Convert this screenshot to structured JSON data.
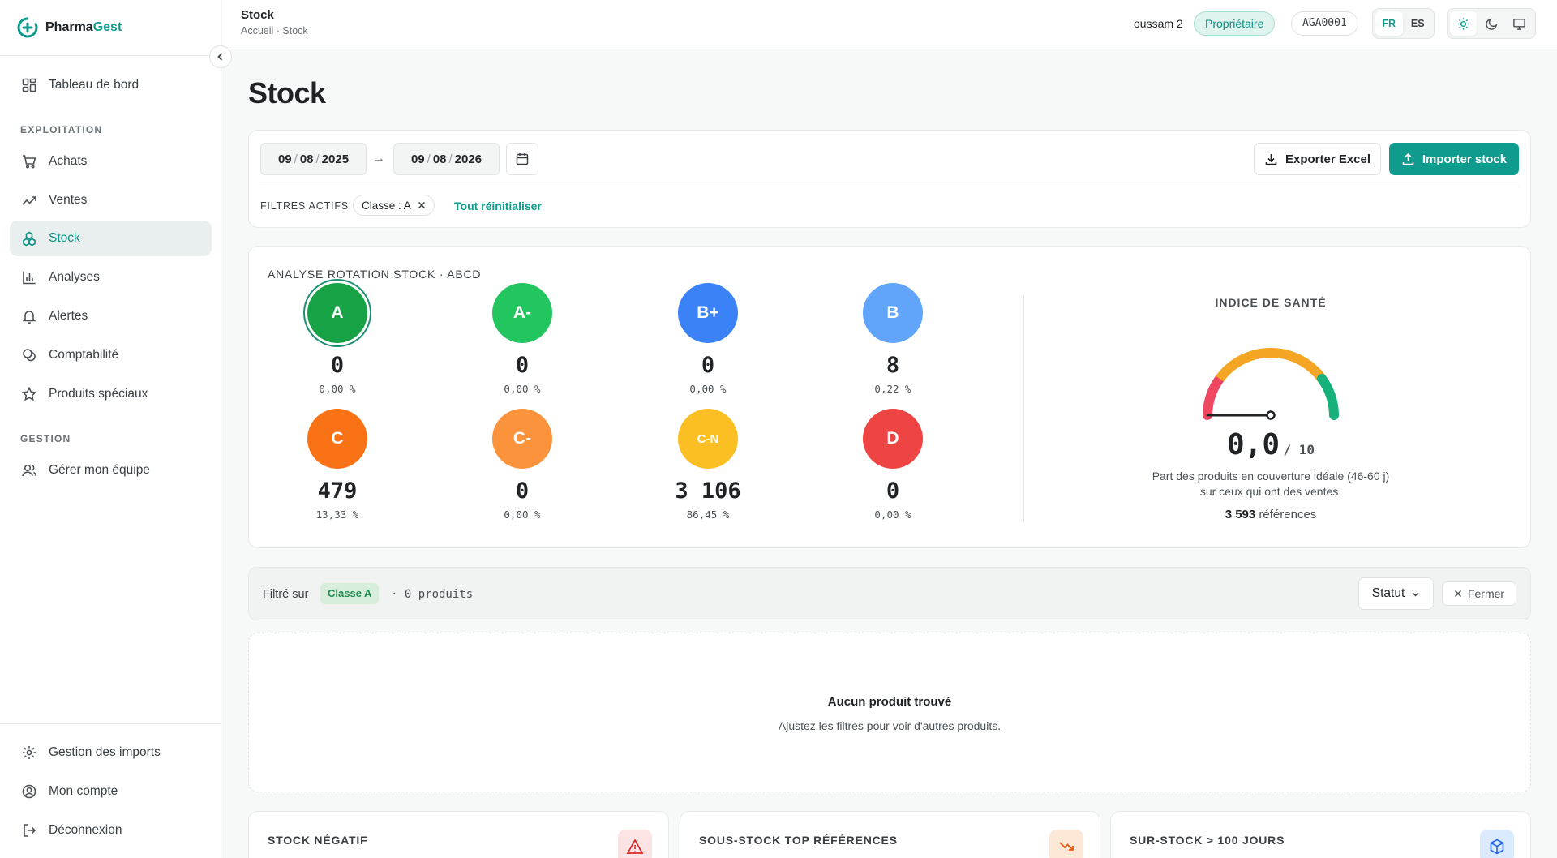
{
  "app": {
    "name_part1": "Pharma",
    "name_part2": "Gest"
  },
  "sidebar": {
    "dashboard": "Tableau de bord",
    "section_exploitation": "EXPLOITATION",
    "achats": "Achats",
    "ventes": "Ventes",
    "stock": "Stock",
    "analyses": "Analyses",
    "alertes": "Alertes",
    "comptabilite": "Comptabilité",
    "produits_speciaux": "Produits spéciaux",
    "section_gestion": "GESTION",
    "equipe": "Gérer mon équipe",
    "imports": "Gestion des imports",
    "compte": "Mon compte",
    "deconnexion": "Déconnexion"
  },
  "topbar": {
    "title": "Stock",
    "breadcrumb": "Accueil · Stock",
    "user": "oussam 2",
    "role": "Propriétaire",
    "code": "AGA0001",
    "lang_fr": "FR",
    "lang_es": "ES"
  },
  "page": {
    "title": "Stock"
  },
  "filters": {
    "date_from": {
      "d": "09",
      "m": "08",
      "y": "2025"
    },
    "date_to": {
      "d": "09",
      "m": "08",
      "y": "2026"
    },
    "arrow": "→",
    "export": "Exporter Excel",
    "import": "Importer stock",
    "active_label": "FILTRES ACTIFS",
    "chip": "Classe : A",
    "reset": "Tout réinitialiser"
  },
  "abcd": {
    "title": "ANALYSE ROTATION STOCK · ABCD",
    "classes": [
      {
        "label": "A",
        "count": "0",
        "pct": "0,00 %",
        "color": "#17a345"
      },
      {
        "label": "A-",
        "count": "0",
        "pct": "0,00 %",
        "color": "#22c55e"
      },
      {
        "label": "B+",
        "count": "0",
        "pct": "0,00 %",
        "color": "#3b82f6"
      },
      {
        "label": "B",
        "count": "8",
        "pct": "0,22 %",
        "color": "#60a5fa"
      },
      {
        "label": "C",
        "count": "479",
        "pct": "13,33 %",
        "color": "#f97316"
      },
      {
        "label": "C-",
        "count": "0",
        "pct": "0,00 %",
        "color": "#fb923c"
      },
      {
        "label": "C-N",
        "count": "3 106",
        "pct": "86,45 %",
        "color": "#fbbf24"
      },
      {
        "label": "D",
        "count": "0",
        "pct": "0,00 %",
        "color": "#ef4444"
      }
    ],
    "health": {
      "title": "INDICE DE SANTÉ",
      "score": "0,0",
      "max": "/ 10",
      "value": 0,
      "desc": "Part des produits en couverture idéale (46-60 j) sur ceux qui ont des ventes.",
      "refs_count": "3 593",
      "refs_label": "références"
    }
  },
  "results": {
    "filtered_on": "Filtré sur",
    "badge": "Classe A",
    "count": "· 0 produits",
    "statut": "Statut",
    "close": "Fermer",
    "empty_title": "Aucun produit trouvé",
    "empty_sub": "Ajustez les filtres pour voir d'autres produits."
  },
  "kpis": [
    {
      "title": "STOCK NÉGATIF",
      "icon": "warning-icon"
    },
    {
      "title": "SOUS-STOCK TOP RÉFÉRENCES",
      "icon": "trending-down-icon"
    },
    {
      "title": "SUR-STOCK > 100 JOURS",
      "icon": "boxes-icon"
    }
  ]
}
